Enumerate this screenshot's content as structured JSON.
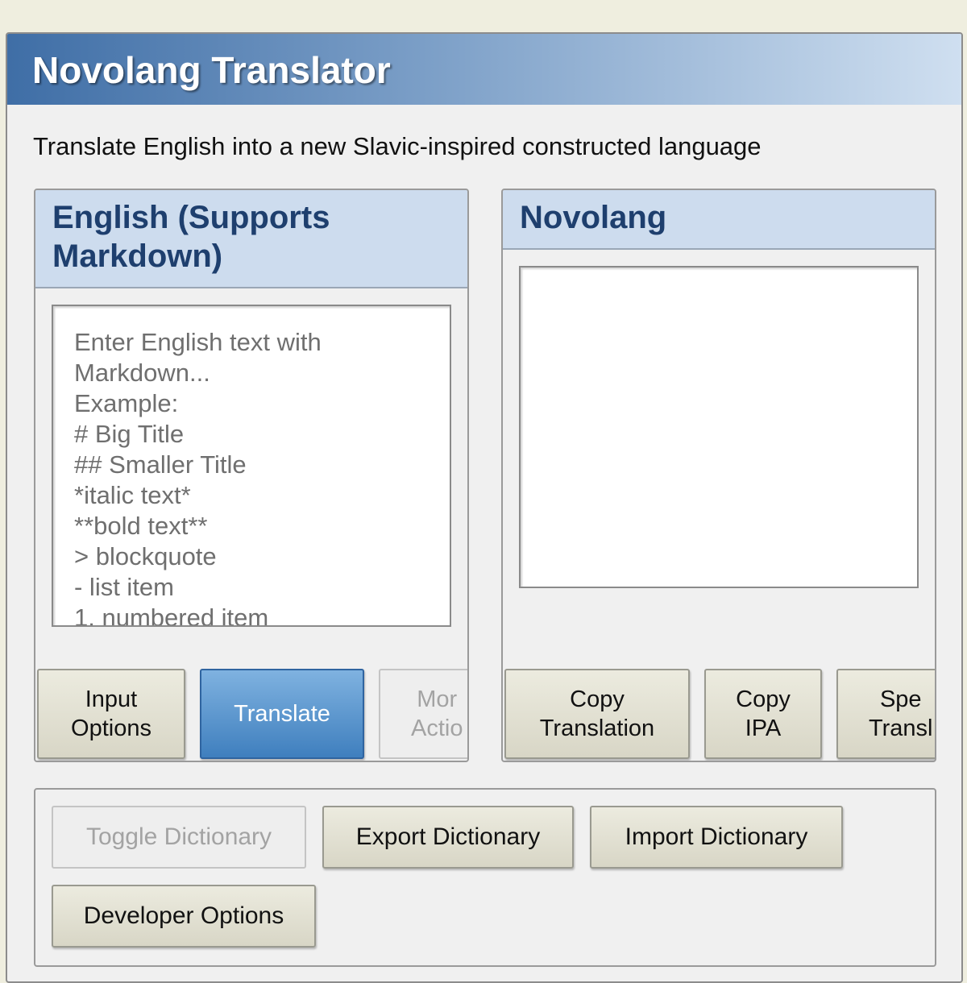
{
  "app": {
    "title": "Novolang Translator",
    "subtitle": "Translate English into a new Slavic-inspired constructed language"
  },
  "input_panel": {
    "title": "English (Supports Markdown)",
    "placeholder_lines": [
      "Enter English text with",
      "Markdown...",
      "Example:",
      "# Big Title",
      "## Smaller Title",
      "*italic text*",
      "**bold text**",
      "> blockquote",
      "- list item",
      "1. numbered item"
    ],
    "buttons": {
      "input_options": "Input\nOptions",
      "translate": "Translate",
      "more_actions": "Mor\nActio"
    }
  },
  "output_panel": {
    "title": "Novolang",
    "value": "",
    "buttons": {
      "copy_translation": "Copy\nTranslation",
      "copy_ipa": "Copy\nIPA",
      "speak_translation": "Spe\nTransl"
    }
  },
  "dictionary": {
    "toggle": "Toggle Dictionary",
    "export": "Export Dictionary",
    "import": "Import Dictionary",
    "developer": "Developer Options"
  }
}
